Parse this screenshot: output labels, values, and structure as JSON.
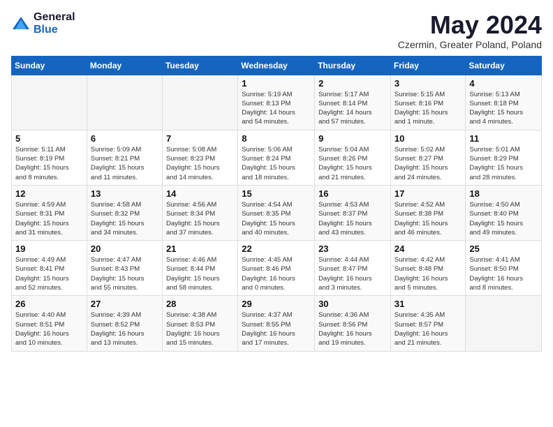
{
  "logo": {
    "general": "General",
    "blue": "Blue"
  },
  "title": {
    "month": "May 2024",
    "location": "Czermin, Greater Poland, Poland"
  },
  "headers": [
    "Sunday",
    "Monday",
    "Tuesday",
    "Wednesday",
    "Thursday",
    "Friday",
    "Saturday"
  ],
  "weeks": [
    [
      {
        "day": "",
        "detail": ""
      },
      {
        "day": "",
        "detail": ""
      },
      {
        "day": "",
        "detail": ""
      },
      {
        "day": "1",
        "detail": "Sunrise: 5:19 AM\nSunset: 8:13 PM\nDaylight: 14 hours\nand 54 minutes."
      },
      {
        "day": "2",
        "detail": "Sunrise: 5:17 AM\nSunset: 8:14 PM\nDaylight: 14 hours\nand 57 minutes."
      },
      {
        "day": "3",
        "detail": "Sunrise: 5:15 AM\nSunset: 8:16 PM\nDaylight: 15 hours\nand 1 minute."
      },
      {
        "day": "4",
        "detail": "Sunrise: 5:13 AM\nSunset: 8:18 PM\nDaylight: 15 hours\nand 4 minutes."
      }
    ],
    [
      {
        "day": "5",
        "detail": "Sunrise: 5:11 AM\nSunset: 8:19 PM\nDaylight: 15 hours\nand 8 minutes."
      },
      {
        "day": "6",
        "detail": "Sunrise: 5:09 AM\nSunset: 8:21 PM\nDaylight: 15 hours\nand 11 minutes."
      },
      {
        "day": "7",
        "detail": "Sunrise: 5:08 AM\nSunset: 8:23 PM\nDaylight: 15 hours\nand 14 minutes."
      },
      {
        "day": "8",
        "detail": "Sunrise: 5:06 AM\nSunset: 8:24 PM\nDaylight: 15 hours\nand 18 minutes."
      },
      {
        "day": "9",
        "detail": "Sunrise: 5:04 AM\nSunset: 8:26 PM\nDaylight: 15 hours\nand 21 minutes."
      },
      {
        "day": "10",
        "detail": "Sunrise: 5:02 AM\nSunset: 8:27 PM\nDaylight: 15 hours\nand 24 minutes."
      },
      {
        "day": "11",
        "detail": "Sunrise: 5:01 AM\nSunset: 8:29 PM\nDaylight: 15 hours\nand 28 minutes."
      }
    ],
    [
      {
        "day": "12",
        "detail": "Sunrise: 4:59 AM\nSunset: 8:31 PM\nDaylight: 15 hours\nand 31 minutes."
      },
      {
        "day": "13",
        "detail": "Sunrise: 4:58 AM\nSunset: 8:32 PM\nDaylight: 15 hours\nand 34 minutes."
      },
      {
        "day": "14",
        "detail": "Sunrise: 4:56 AM\nSunset: 8:34 PM\nDaylight: 15 hours\nand 37 minutes."
      },
      {
        "day": "15",
        "detail": "Sunrise: 4:54 AM\nSunset: 8:35 PM\nDaylight: 15 hours\nand 40 minutes."
      },
      {
        "day": "16",
        "detail": "Sunrise: 4:53 AM\nSunset: 8:37 PM\nDaylight: 15 hours\nand 43 minutes."
      },
      {
        "day": "17",
        "detail": "Sunrise: 4:52 AM\nSunset: 8:38 PM\nDaylight: 15 hours\nand 46 minutes."
      },
      {
        "day": "18",
        "detail": "Sunrise: 4:50 AM\nSunset: 8:40 PM\nDaylight: 15 hours\nand 49 minutes."
      }
    ],
    [
      {
        "day": "19",
        "detail": "Sunrise: 4:49 AM\nSunset: 8:41 PM\nDaylight: 15 hours\nand 52 minutes."
      },
      {
        "day": "20",
        "detail": "Sunrise: 4:47 AM\nSunset: 8:43 PM\nDaylight: 15 hours\nand 55 minutes."
      },
      {
        "day": "21",
        "detail": "Sunrise: 4:46 AM\nSunset: 8:44 PM\nDaylight: 15 hours\nand 58 minutes."
      },
      {
        "day": "22",
        "detail": "Sunrise: 4:45 AM\nSunset: 8:46 PM\nDaylight: 16 hours\nand 0 minutes."
      },
      {
        "day": "23",
        "detail": "Sunrise: 4:44 AM\nSunset: 8:47 PM\nDaylight: 16 hours\nand 3 minutes."
      },
      {
        "day": "24",
        "detail": "Sunrise: 4:42 AM\nSunset: 8:48 PM\nDaylight: 16 hours\nand 5 minutes."
      },
      {
        "day": "25",
        "detail": "Sunrise: 4:41 AM\nSunset: 8:50 PM\nDaylight: 16 hours\nand 8 minutes."
      }
    ],
    [
      {
        "day": "26",
        "detail": "Sunrise: 4:40 AM\nSunset: 8:51 PM\nDaylight: 16 hours\nand 10 minutes."
      },
      {
        "day": "27",
        "detail": "Sunrise: 4:39 AM\nSunset: 8:52 PM\nDaylight: 16 hours\nand 13 minutes."
      },
      {
        "day": "28",
        "detail": "Sunrise: 4:38 AM\nSunset: 8:53 PM\nDaylight: 16 hours\nand 15 minutes."
      },
      {
        "day": "29",
        "detail": "Sunrise: 4:37 AM\nSunset: 8:55 PM\nDaylight: 16 hours\nand 17 minutes."
      },
      {
        "day": "30",
        "detail": "Sunrise: 4:36 AM\nSunset: 8:56 PM\nDaylight: 16 hours\nand 19 minutes."
      },
      {
        "day": "31",
        "detail": "Sunrise: 4:35 AM\nSunset: 8:57 PM\nDaylight: 16 hours\nand 21 minutes."
      },
      {
        "day": "",
        "detail": ""
      }
    ]
  ]
}
